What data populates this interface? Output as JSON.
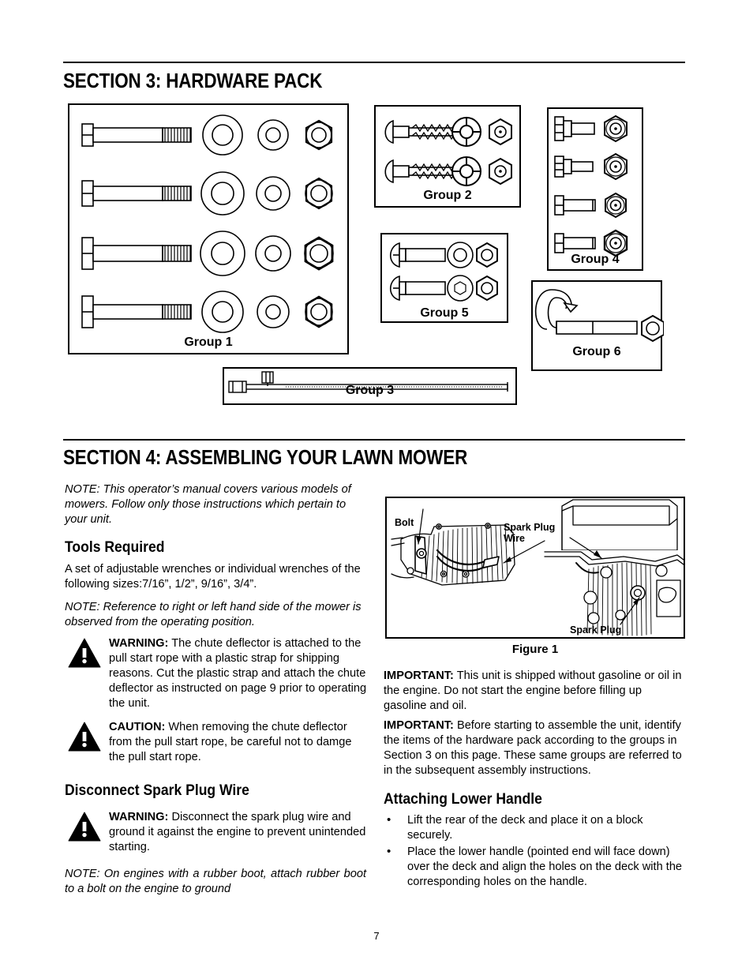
{
  "page": {
    "number": "7"
  },
  "section3": {
    "heading": "SECTION 3:  HARDWARE PACK",
    "groups": [
      {
        "id": "group1",
        "label": "Group 1",
        "contents": "4 shoulder bolts, 4 large washers, 4 small washers, 4 hex nuts"
      },
      {
        "id": "group2",
        "label": "Group 2",
        "contents": "2 carriage bolts, 2 flanged knobs, 2 hex nuts"
      },
      {
        "id": "group3",
        "label": "Group 3",
        "contents": "1 long rod"
      },
      {
        "id": "group4",
        "label": "Group 4",
        "contents": "4 hex head bolts, 4 hex nuts"
      },
      {
        "id": "group5",
        "label": "Group 5",
        "contents": "2 carriage bolts, 2 washers, 2 hex nuts"
      },
      {
        "id": "group6",
        "label": "Group 6",
        "contents": "1 J-hook bolt, 1 hex nut"
      }
    ]
  },
  "section4": {
    "heading": "SECTION 4:  ASSEMBLING YOUR LAWN MOWER",
    "intro_note": "NOTE: This operator’s manual covers various models of mowers. Follow only those instructions which pertain to your unit.",
    "tools": {
      "heading": "Tools Required",
      "body": "A set of adjustable wrenches or individual wrenches of the following sizes:7/16”, 1/2”, 9/16”, 3/4”.",
      "note": "NOTE: Reference to right or left hand side of the mower is observed from the operating position."
    },
    "warning1": {
      "label": "WARNING:",
      "text": " The chute deflector is attached to the pull start rope with a plastic strap for shipping reasons. Cut the plastic strap and attach the chute deflector as instructed on page 9 prior to operating the unit."
    },
    "caution1": {
      "label": "CAUTION:",
      "text": " When removing the chute deflector from the pull start rope, be careful not to damge the pull start rope."
    },
    "disconnect": {
      "heading": "Disconnect Spark Plug Wire",
      "warning": {
        "label": "WARNING:",
        "text": " Disconnect the spark plug wire and ground it against the engine to prevent unintended starting."
      },
      "note": "NOTE: On engines with a rubber boot, attach rubber boot to a bolt on the engine to ground"
    },
    "figure1": {
      "caption": "Figure 1",
      "labels": {
        "bolt": "Bolt",
        "spark_plug_wire": "Spark Plug\nWire",
        "spark_plug": "Spark Plug"
      }
    },
    "important1": {
      "label": "IMPORTANT:",
      "text": "  This unit is shipped without gasoline or oil in the engine. Do not start the engine before filling up gasoline and oil."
    },
    "important2": {
      "label": "IMPORTANT:",
      "text": "  Before starting to assemble the unit, identify the items of the hardware pack according to the groups in Section 3 on this page. These same groups are referred to in the subsequent assembly instructions."
    },
    "attaching": {
      "heading": "Attaching Lower Handle",
      "bullets": [
        "Lift the rear of the deck and place it on a block securely.",
        "Place the lower handle (pointed end will face down) over the deck and align the holes on the deck with the corresponding holes on the handle."
      ]
    }
  },
  "colors": {
    "ink": "#000000",
    "paper": "#ffffff"
  }
}
